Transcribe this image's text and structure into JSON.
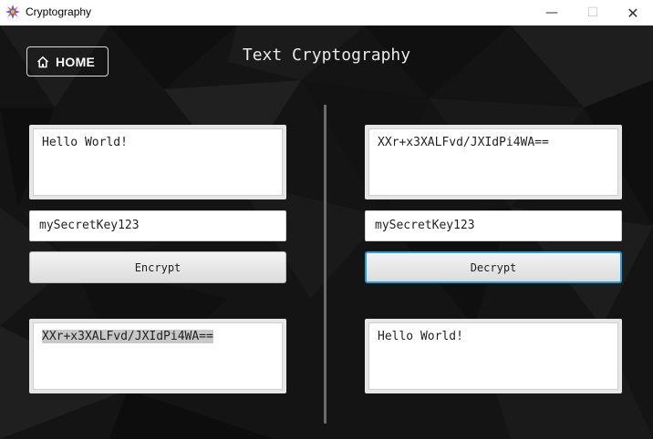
{
  "window": {
    "title": "Cryptography",
    "minimize_glyph": "—",
    "maximize_glyph": "☐",
    "close_glyph": "✕"
  },
  "header": {
    "home_label": "HOME",
    "page_title": "Text Cryptography"
  },
  "encrypt_panel": {
    "input_text": "Hello World!",
    "key_value": "mySecretKey123",
    "button_label": "Encrypt",
    "output_text": "XXr+x3XALFvd/JXIdPi4WA=="
  },
  "decrypt_panel": {
    "input_text": "XXr+x3XALFvd/JXIdPi4WA==",
    "key_value": "mySecretKey123",
    "button_label": "Decrypt",
    "output_text": "Hello World!"
  },
  "colors": {
    "background": "#141414",
    "focus_accent": "#2a9fd6"
  }
}
